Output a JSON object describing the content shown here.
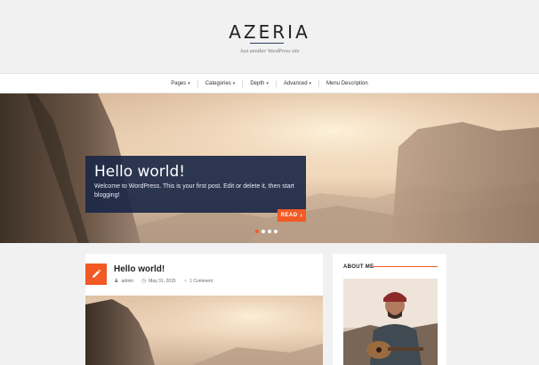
{
  "site": {
    "title": "AZERIA",
    "tagline": "Just another WordPress site"
  },
  "nav": {
    "items": [
      {
        "label": "Pages",
        "has_dropdown": true
      },
      {
        "label": "Categories",
        "has_dropdown": true
      },
      {
        "label": "Depth",
        "has_dropdown": true
      },
      {
        "label": "Advanced",
        "has_dropdown": true
      },
      {
        "label": "Menu Description",
        "has_dropdown": false
      }
    ],
    "caret": "▾"
  },
  "hero": {
    "title": "Hello world!",
    "excerpt": "Welcome to WordPress. This is your first post. Edit or delete it, then start blogging!",
    "read_label": "READ",
    "read_arrow": "›",
    "slides_count": 4,
    "active_slide": 1
  },
  "post": {
    "title": "Hello world!",
    "author": "admin",
    "date": "May 31, 2015",
    "comments": "1 Comment",
    "icon": "pencil-icon"
  },
  "sidebar": {
    "widget_title": "ABOUT ME"
  },
  "colors": {
    "accent": "#f15a24",
    "hero_card": "#1c2846",
    "background": "#f1f1f1"
  }
}
